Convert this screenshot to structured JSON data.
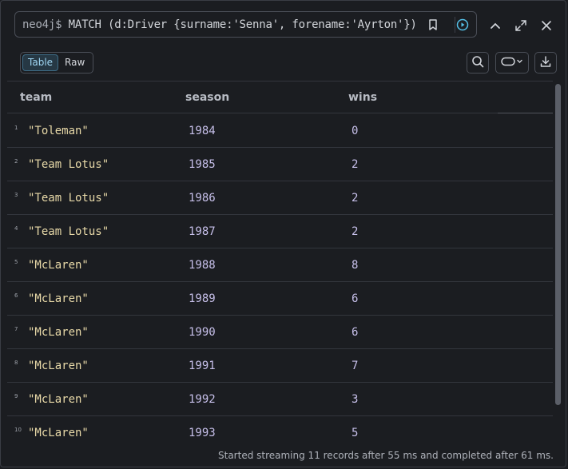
{
  "query": {
    "prompt": "neo4j$",
    "text": "MATCH (d:Driver {surname:'Senna', forename:'Ayrton'}) MA"
  },
  "view_toggle": {
    "options": [
      "Table",
      "Raw"
    ],
    "selected": "Table"
  },
  "icons": {
    "bookmark": "bookmark-icon",
    "run": "play-circle-icon",
    "collapse": "chevron-up-icon",
    "fullscreen": "expand-icon",
    "close": "close-icon",
    "search": "search-icon",
    "toggle": "toggle-switch-icon",
    "download": "download-icon"
  },
  "table": {
    "columns": [
      "team",
      "season",
      "wins"
    ],
    "rows": [
      {
        "n": "1",
        "team": "\"Toleman\"",
        "season": "1984",
        "wins": "0"
      },
      {
        "n": "2",
        "team": "\"Team Lotus\"",
        "season": "1985",
        "wins": "2"
      },
      {
        "n": "3",
        "team": "\"Team Lotus\"",
        "season": "1986",
        "wins": "2"
      },
      {
        "n": "4",
        "team": "\"Team Lotus\"",
        "season": "1987",
        "wins": "2"
      },
      {
        "n": "5",
        "team": "\"McLaren\"",
        "season": "1988",
        "wins": "8"
      },
      {
        "n": "6",
        "team": "\"McLaren\"",
        "season": "1989",
        "wins": "6"
      },
      {
        "n": "7",
        "team": "\"McLaren\"",
        "season": "1990",
        "wins": "6"
      },
      {
        "n": "8",
        "team": "\"McLaren\"",
        "season": "1991",
        "wins": "7"
      },
      {
        "n": "9",
        "team": "\"McLaren\"",
        "season": "1992",
        "wins": "3"
      },
      {
        "n": "10",
        "team": "\"McLaren\"",
        "season": "1993",
        "wins": "5"
      }
    ]
  },
  "status": "Started streaming 11 records after 55 ms and completed after 61 ms.",
  "colors": {
    "background": "#1b1d21",
    "string_value": "#e8d9a8",
    "number_value": "#c6bfe9",
    "accent": "#55c1e8"
  }
}
